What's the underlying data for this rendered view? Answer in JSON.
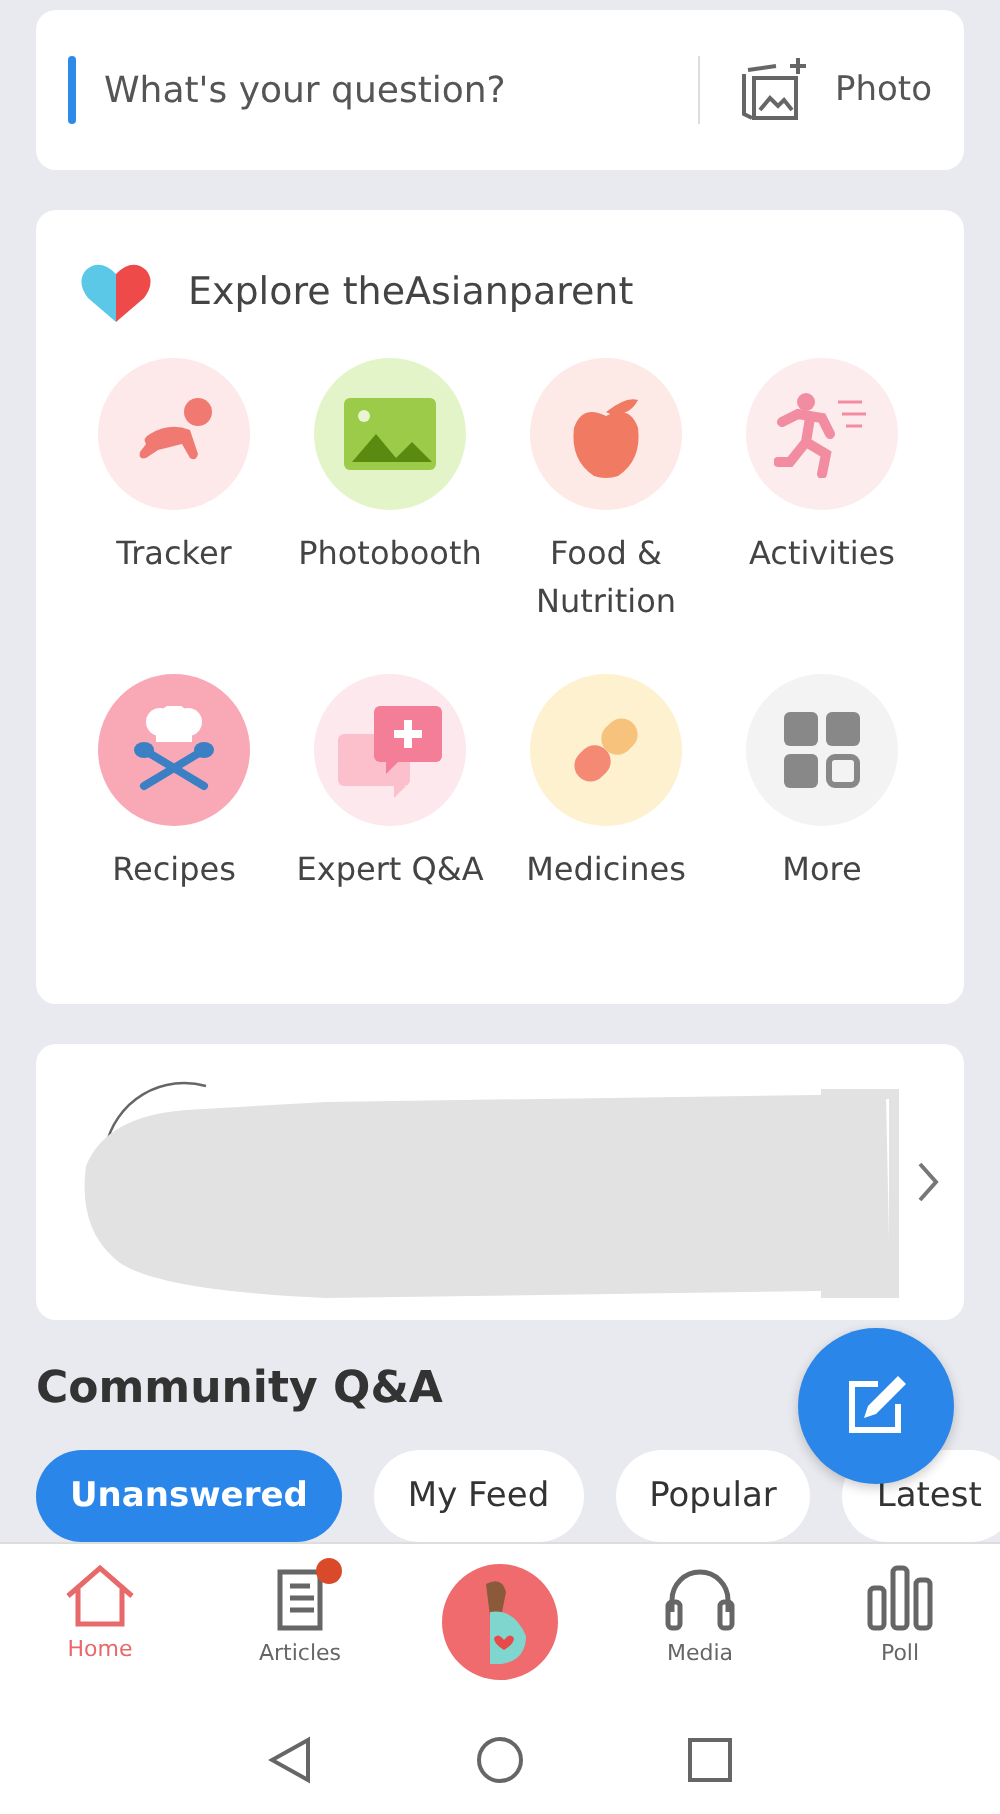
{
  "ask_bar": {
    "placeholder": "What's your question?",
    "photo_label": "Photo"
  },
  "explore": {
    "title": "Explore theAsianparent",
    "items": [
      {
        "label": "Tracker",
        "color": "#fde9e9"
      },
      {
        "label": "Photobooth",
        "color": "#e3f5c8"
      },
      {
        "label": "Food & Nutrition",
        "color": "#fde9e6"
      },
      {
        "label": "Activities",
        "color": "#fdeced"
      },
      {
        "label": "Recipes",
        "color": "#f9a9b6"
      },
      {
        "label": "Expert Q&A",
        "color": "#fde8ed"
      },
      {
        "label": "Medicines",
        "color": "#fdf1cf"
      },
      {
        "label": "More",
        "color": "#f3f3f3"
      }
    ]
  },
  "featured_card": {
    "kind": "redacted"
  },
  "community": {
    "title": "Community Q&A",
    "tabs": [
      {
        "label": "Unanswered",
        "selected": true
      },
      {
        "label": "My Feed",
        "selected": false
      },
      {
        "label": "Popular",
        "selected": false
      },
      {
        "label": "Latest",
        "selected": false
      }
    ]
  },
  "bottom_nav": [
    {
      "kind": "tab",
      "label": "Home",
      "selected": true,
      "badge": false
    },
    {
      "kind": "tab",
      "label": "Articles",
      "selected": false,
      "badge": true
    },
    {
      "kind": "avatar",
      "selected": false
    },
    {
      "kind": "tab",
      "label": "Media",
      "selected": false,
      "badge": false
    },
    {
      "kind": "tab",
      "label": "Poll",
      "selected": false,
      "badge": false
    }
  ]
}
